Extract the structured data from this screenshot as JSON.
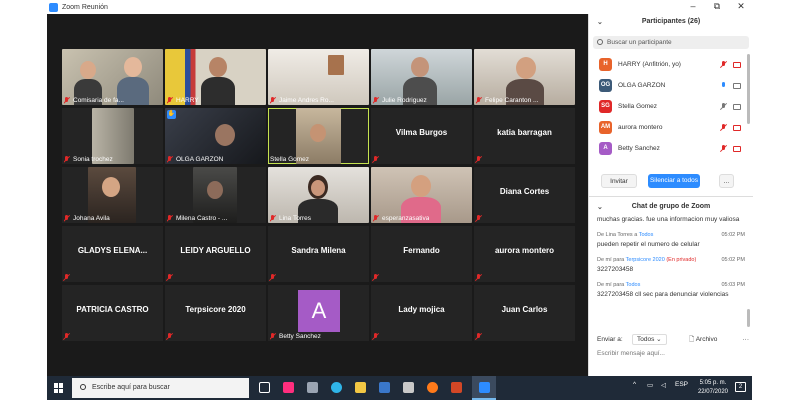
{
  "window": {
    "title": "Zoom Reunión",
    "minimize": "–",
    "maximize": "⧉",
    "close": "✕"
  },
  "tiles": [
    {
      "label": "Comisaria de fa...",
      "video": true
    },
    {
      "label": "HARRY",
      "video": true
    },
    {
      "label": "Jaime Andres Ro...",
      "video": true
    },
    {
      "label": "Julie Rodriguez",
      "video": true
    },
    {
      "label": "Felipe Caranton ...",
      "video": true
    },
    {
      "label": "Sonia trochez",
      "video": true
    },
    {
      "label": "OLGA GARZON",
      "video": true
    },
    {
      "label": "Stella Gomez",
      "video": true
    },
    {
      "label": "Vilma Burgos",
      "video": false
    },
    {
      "label": "katia barragan",
      "video": false
    },
    {
      "label": "Johana Avila",
      "video": true
    },
    {
      "label": "Milena Castro - ...",
      "video": true
    },
    {
      "label": "Lina Torres",
      "video": true
    },
    {
      "label": "esperanzasativa",
      "video": true
    },
    {
      "label": "Diana Cortes",
      "video": false
    },
    {
      "label": "GLADYS ELENA...",
      "video": false
    },
    {
      "label": "LEIDY ARGUELLO",
      "video": false
    },
    {
      "label": "Sandra Milena",
      "video": false
    },
    {
      "label": "Fernando",
      "video": false
    },
    {
      "label": "aurora montero",
      "video": false
    },
    {
      "label": "PATRICIA CASTRO",
      "video": false
    },
    {
      "label": "Terpsicore 2020",
      "video": false
    },
    {
      "label": "Betty Sanchez",
      "video": false,
      "avatar": "A"
    },
    {
      "label": "Lady mojica",
      "video": false
    },
    {
      "label": "Juan Carlos",
      "video": false
    }
  ],
  "participants_panel": {
    "title": "Participantes (26)",
    "search_placeholder": "Buscar un participante",
    "list": [
      {
        "initials": "H",
        "name": "HARRY (Anfitrión, yo)",
        "color": "#e8632b"
      },
      {
        "initials": "OG",
        "name": "OLGA GARZON",
        "color": "#3c5a78"
      },
      {
        "initials": "SG",
        "name": "Stella Gomez",
        "color": "#e02828"
      },
      {
        "initials": "AM",
        "name": "aurora montero",
        "color": "#e8632b"
      },
      {
        "initials": "A",
        "name": "Betty Sanchez",
        "color": "#a55bc6"
      }
    ],
    "invite_label": "Invitar",
    "mute_all_label": "Silenciar a todos",
    "more_label": "..."
  },
  "chat_panel": {
    "title": "Chat de grupo de Zoom",
    "messages": [
      {
        "from": "",
        "to": "",
        "private": "",
        "time": "",
        "text": "muchas gracias. fue una informacion muy valiosa"
      },
      {
        "from": "De Lina Torres a ",
        "to": "Todos",
        "private": "",
        "time": "05:02 PM",
        "text": "pueden repetir el numero de celular"
      },
      {
        "from": "De mí para ",
        "to": "Terpsicore 2020",
        "private": "(En privado)",
        "time": "05:02 PM",
        "text": "3227203458"
      },
      {
        "from": "De mí para ",
        "to": "Todos",
        "private": "",
        "time": "05:03 PM",
        "text": "3227203458 cll sec para denunciar violencias"
      }
    ],
    "send_to_label": "Enviar a:",
    "send_to_value": "Todos",
    "file_label": "Archivo",
    "more_label": "···",
    "input_placeholder": "Escribir mensaje aquí..."
  },
  "taskbar": {
    "search_placeholder": "Escribe aquí para buscar",
    "language": "ESP",
    "time": "5:05 p. m.",
    "date": "22/07/2020",
    "notifications": "2"
  }
}
